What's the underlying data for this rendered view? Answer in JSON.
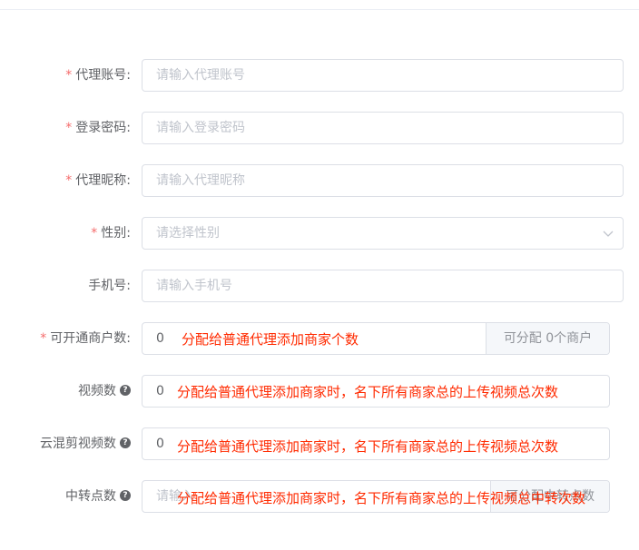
{
  "form": {
    "agent_account": {
      "label": "代理账号:",
      "placeholder": "请输入代理账号"
    },
    "login_password": {
      "label": "登录密码:",
      "placeholder": "请输入登录密码"
    },
    "agent_nickname": {
      "label": "代理昵称:",
      "placeholder": "请输入代理昵称"
    },
    "gender": {
      "label": "性别:",
      "placeholder": "请选择性别"
    },
    "phone": {
      "label": "手机号:",
      "placeholder": "请输入手机号"
    },
    "merchant_count": {
      "label": "可开通商户数:",
      "value": "0",
      "append": "可分配 0个商户"
    },
    "video_count": {
      "label": "视频数",
      "value": "0"
    },
    "cloud_edit_video_count": {
      "label": "云混剪视频数",
      "value": "0"
    },
    "relay_points": {
      "label": "中转点数",
      "placeholder": "请输入",
      "append": "可分配中转点数"
    },
    "required_mark": "*",
    "help_glyph": "?"
  },
  "annotations": {
    "merchant_note": "分配给普通代理添加商家个数",
    "video_note": "分配给普通代理添加商家时，名下所有商家总的上传视频总次数",
    "cloud_note": "分配给普通代理添加商家时，名下所有商家总的上传视频总次数",
    "relay_note": "分配给普通代理添加商家时，名下所有商家总的上传视频总中转次数"
  },
  "colors": {
    "required": "#f56c6c",
    "annotation": "#ff2a00",
    "border": "#dcdfe6"
  }
}
